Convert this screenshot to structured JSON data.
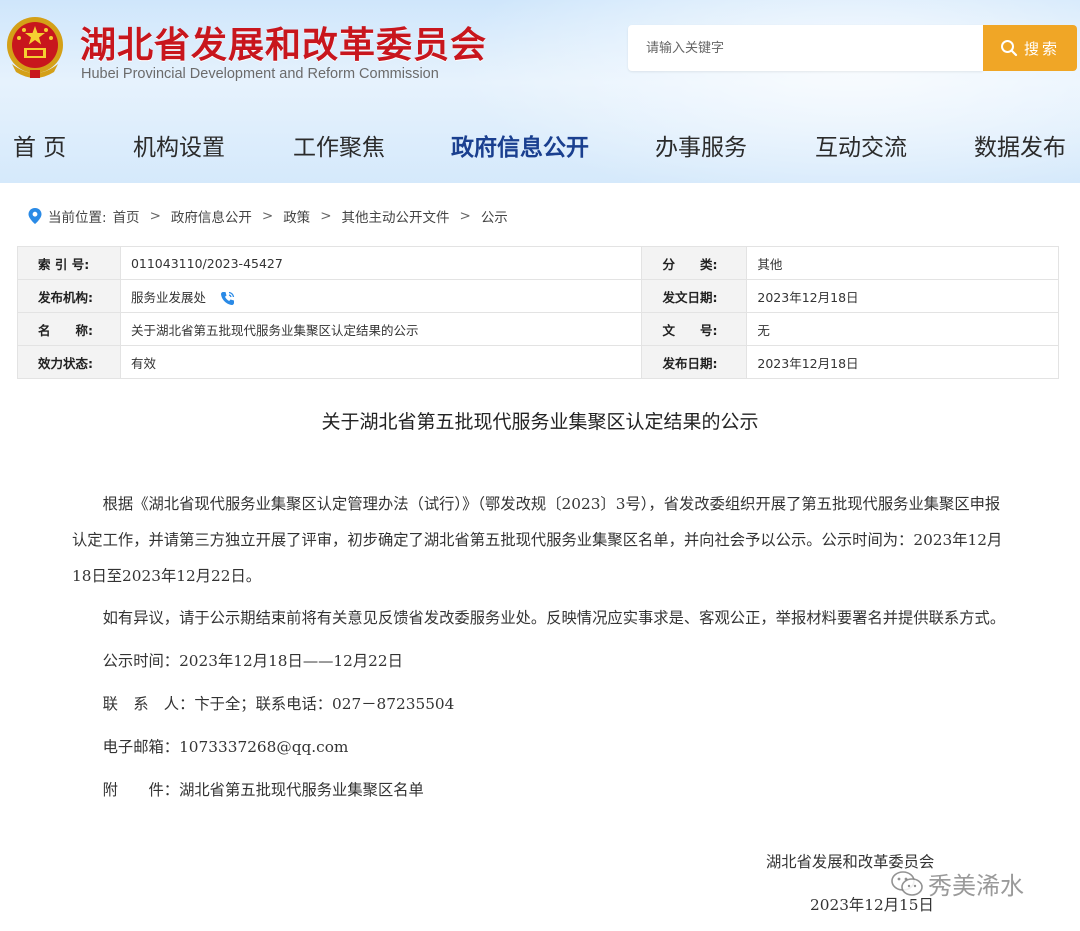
{
  "header": {
    "title": "湖北省发展和改革委员会",
    "subtitle": "Hubei Provincial Development and Reform Commission",
    "search_placeholder": "请输入关键字",
    "search_button": "搜索"
  },
  "nav": {
    "items": [
      "首 页",
      "机构设置",
      "工作聚焦",
      "政府信息公开",
      "办事服务",
      "互动交流",
      "数据发布"
    ],
    "active": "政府信息公开"
  },
  "breadcrumb": {
    "label": "当前位置:",
    "items": [
      "首页",
      "政府信息公开",
      "政策",
      "其他主动公开文件",
      "公示"
    ],
    "separator": ">"
  },
  "info": {
    "index_label": "索 引 号:",
    "index_value": "011043110/2023-45427",
    "category_label": "分　　类:",
    "category_value": "其他",
    "publisher_label": "发布机构:",
    "publisher_value": "服务业发展处",
    "issue_date_label": "发文日期:",
    "issue_date_value": "2023年12月18日",
    "name_label": "名　　称:",
    "name_value": "关于湖北省第五批现代服务业集聚区认定结果的公示",
    "doc_no_label": "文　　号:",
    "doc_no_value": "无",
    "status_label": "效力状态:",
    "status_value": "有效",
    "pub_date_label": "发布日期:",
    "pub_date_value": "2023年12月18日"
  },
  "article": {
    "title": "关于湖北省第五批现代服务业集聚区认定结果的公示",
    "paragraphs": [
      "根据《湖北省现代服务业集聚区认定管理办法（试行）》（鄂发改规〔2023〕3号），省发改委组织开展了第五批现代服务业集聚区申报认定工作，并请第三方独立开展了评审，初步确定了湖北省第五批现代服务业集聚区名单，并向社会予以公示。公示时间为：2023年12月18日至2023年12月22日。",
      "如有异议，请于公示期结束前将有关意见反馈省发改委服务业处。反映情况应实事求是、客观公正，举报材料要署名并提供联系方式。",
      "公示时间：2023年12月18日——12月22日",
      "联　系　人：卞于全；联系电话：027－87235504",
      "电子邮箱：1073337268@qq.com",
      "附　　件：湖北省第五批现代服务业集聚区名单"
    ],
    "signature": "湖北省发展和改革委员会",
    "date": "2023年12月15日"
  },
  "watermark": "秀美浠水",
  "colors": {
    "title_red": "#c8161d",
    "search_orange": "#f0a626",
    "nav_active": "#1a3f8f",
    "location_blue": "#2a8ae6"
  }
}
